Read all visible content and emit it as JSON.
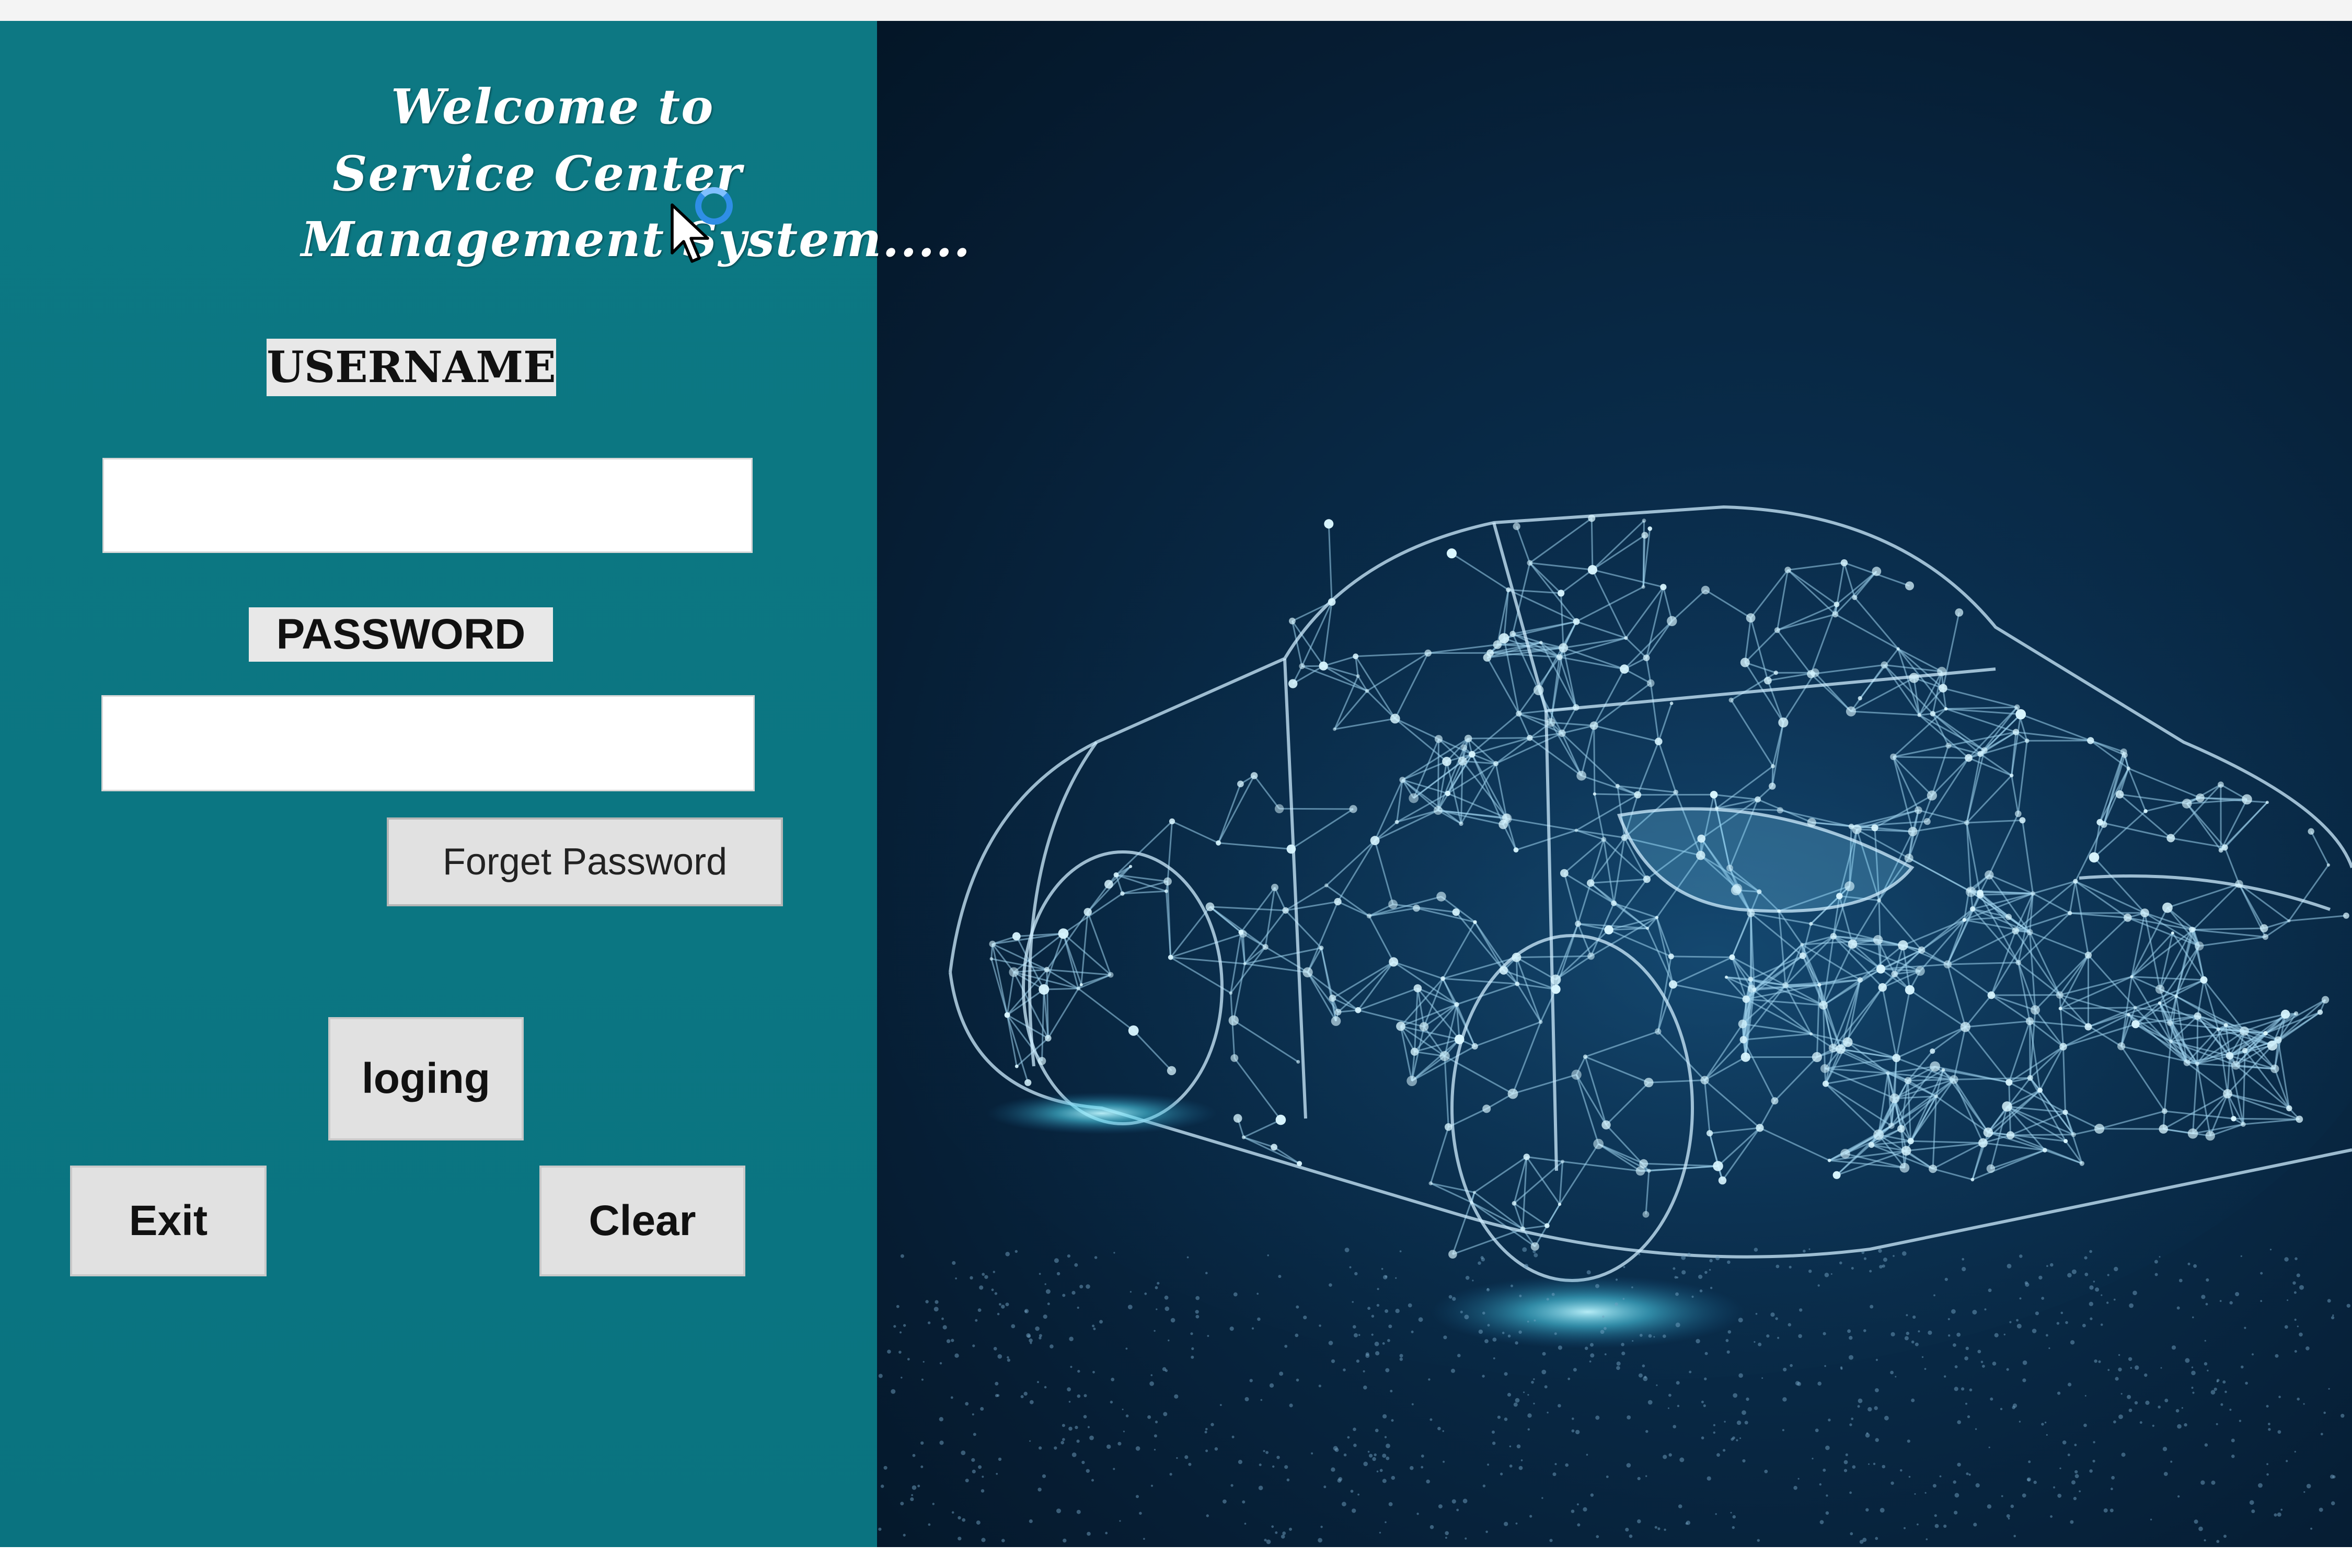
{
  "window": {
    "title_lines": [
      "Welcome to",
      "Service Center",
      "Management System....."
    ]
  },
  "login_form": {
    "username_label": "USERNAME",
    "username_value": "",
    "password_label": "PASSWORD",
    "password_value": "",
    "forget_password_label": "Forget Password",
    "login_label": "loging",
    "exit_label": "Exit",
    "clear_label": "Clear"
  },
  "colors": {
    "panel_background": "#0b7682",
    "image_background": "#082844",
    "button_face": "#e1e1e1",
    "label_face": "#e8e8e8"
  },
  "icons": {
    "cursor": "mouse-pointer-icon",
    "busy": "busy-spinner-icon"
  },
  "image": {
    "subject": "wireframe car illustration"
  }
}
